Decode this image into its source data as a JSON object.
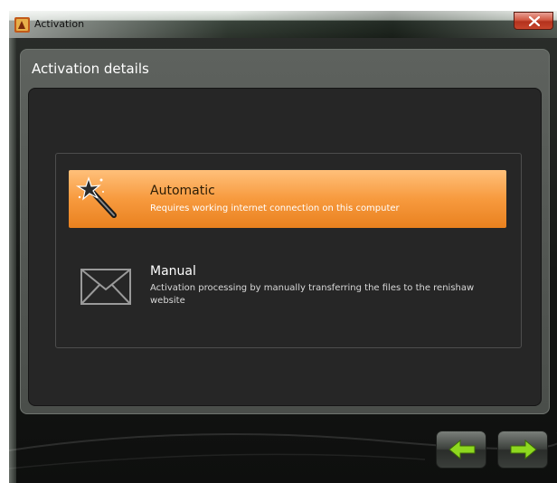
{
  "window": {
    "title": "Activation",
    "close_icon": "close-icon"
  },
  "panel": {
    "header": "Activation details"
  },
  "options": [
    {
      "title": "Automatic",
      "description": "Requires working internet connection on this computer",
      "icon": "magic-wand-icon",
      "selected": true
    },
    {
      "title": "Manual",
      "description": "Activation processing by manually transferring the files to the renishaw website",
      "icon": "envelope-icon",
      "selected": false
    }
  ],
  "navigation": {
    "back_icon": "arrow-left-icon",
    "next_icon": "arrow-right-icon"
  },
  "colors": {
    "selected_option": "#f79a3e",
    "panel_background": "#262626",
    "close_button": "#c7452c",
    "nav_arrow": "#8ed81f"
  }
}
